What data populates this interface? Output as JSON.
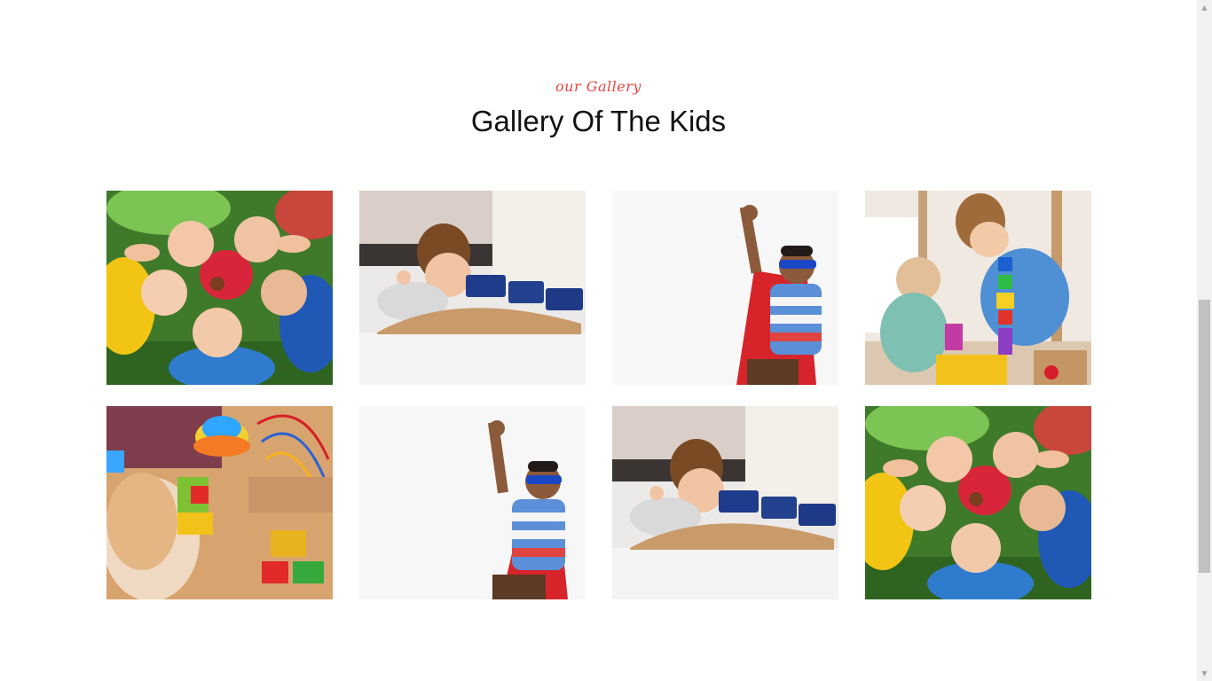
{
  "section": {
    "subtitle": "our Gallery",
    "title": "Gallery Of The Kids"
  },
  "gallery": {
    "images": [
      {
        "name": "kids-circle-photo",
        "subject": "children lying in a circle on grass making binocular hands"
      },
      {
        "name": "boy-train-photo",
        "subject": "boy playing with toy train on wooden bridge"
      },
      {
        "name": "superhero-kid-photo",
        "subject": "boy in superhero mask and cape raising fist"
      },
      {
        "name": "kids-blocks-photo",
        "subject": "two children stacking colorful toy blocks"
      },
      {
        "name": "girl-toys-photo",
        "subject": "girl playing with colorful building bricks and bead maze"
      },
      {
        "name": "superhero-kid-photo",
        "subject": "boy in superhero mask and cape raising fist"
      },
      {
        "name": "boy-train-photo",
        "subject": "boy playing with toy train on wooden bridge"
      },
      {
        "name": "kids-circle-photo",
        "subject": "children lying in a circle on grass making binocular hands"
      }
    ]
  },
  "colors": {
    "accent": "#e8433f",
    "title": "#111111",
    "background": "#ffffff"
  }
}
